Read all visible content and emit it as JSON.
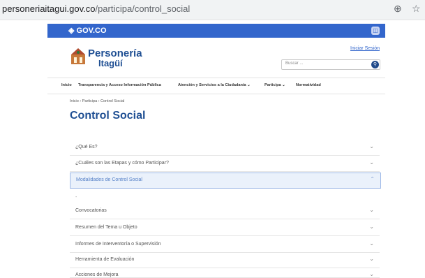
{
  "browser": {
    "url_domain": "personeriaitagui.gov.co",
    "url_path": "/participa/control_social",
    "zoom_icon": "zoom-icon",
    "bookmark_icon": "star-icon"
  },
  "gov_bar": {
    "label": "GOV.CO"
  },
  "header": {
    "logo_line1": "Personería",
    "logo_line2": "Itagüí",
    "login": "Iniciar Sesión",
    "search_placeholder": "Buscar ..."
  },
  "nav": {
    "items": [
      {
        "label": "Inicio"
      },
      {
        "label": "Transparencia y Acceso Información Pública"
      },
      {
        "label": "Atención y Servicios a la Ciudadanía ⌄"
      },
      {
        "label": "Participa ⌄"
      },
      {
        "label": "Normatividad"
      }
    ]
  },
  "breadcrumb": "Inicio › Participa › Control Social",
  "page_title": "Control Social",
  "accordion": [
    {
      "label": "¿Qué Es?",
      "expanded": false
    },
    {
      "label": "¿Cuáles son las Etapas y cómo Participar?",
      "expanded": false
    },
    {
      "label": "Modalidades de Control Social",
      "expanded": true
    },
    {
      "label": "Convocatorias",
      "expanded": false
    },
    {
      "label": "Resumen del Tema u Objeto",
      "expanded": false
    },
    {
      "label": "Informes de Interventoría o Supervisión",
      "expanded": false
    },
    {
      "label": "Herramienta de Evaluación",
      "expanded": false
    },
    {
      "label": "Acciones de Mejora",
      "expanded": false
    }
  ],
  "expanded_content": "-",
  "chevron_down": "⌄",
  "chevron_up": "⌃",
  "colors": {
    "gov_blue": "#3366cc",
    "brand_blue": "#1f4f93",
    "active_bg": "#eaf1fb"
  }
}
